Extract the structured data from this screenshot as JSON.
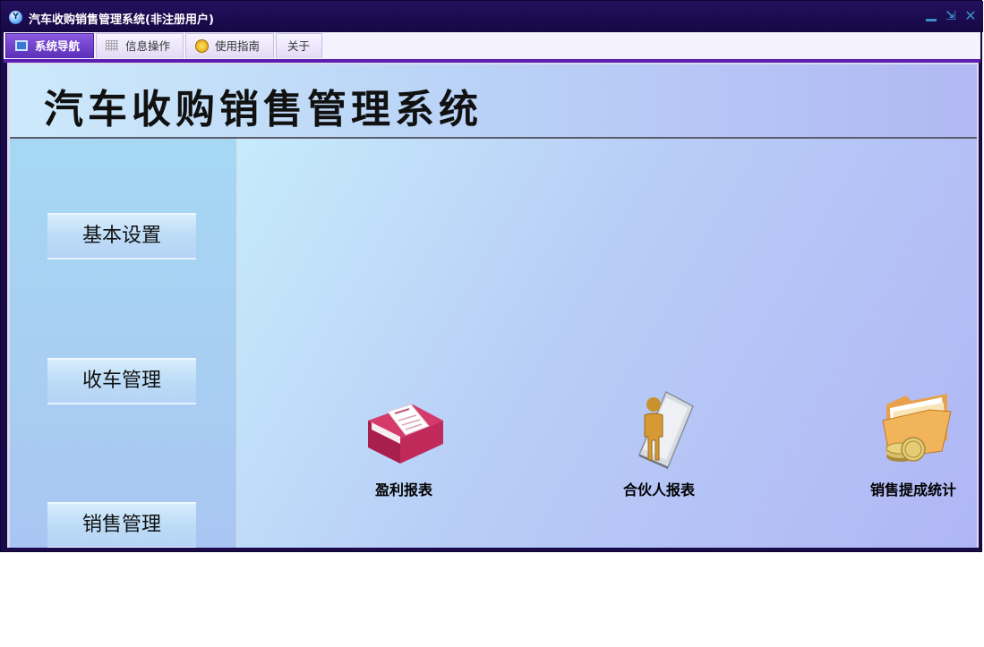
{
  "window": {
    "title": "汽车收购销售管理系统(非注册用户)"
  },
  "menu": {
    "tabs": [
      {
        "label": "系统导航",
        "icon": "monitor-icon",
        "active": true
      },
      {
        "label": "信息操作",
        "icon": "grid-icon",
        "active": false
      },
      {
        "label": "使用指南",
        "icon": "guide-icon",
        "active": false
      },
      {
        "label": "关于",
        "icon": "",
        "active": false
      }
    ]
  },
  "banner": {
    "title": "汽车收购销售管理系统"
  },
  "sidebar": {
    "items": [
      {
        "label": "基本设置"
      },
      {
        "label": "收车管理"
      },
      {
        "label": "销售管理"
      }
    ]
  },
  "reports": [
    {
      "label": "盈利报表",
      "icon": "book-icon"
    },
    {
      "label": "合伙人报表",
      "icon": "person-icon"
    },
    {
      "label": "销售提成统计",
      "icon": "folder-coins-icon"
    }
  ],
  "colors": {
    "titlebar": "#1a0a4a",
    "accent": "#5a1fb0",
    "sidebar": "#a6d8f3"
  }
}
